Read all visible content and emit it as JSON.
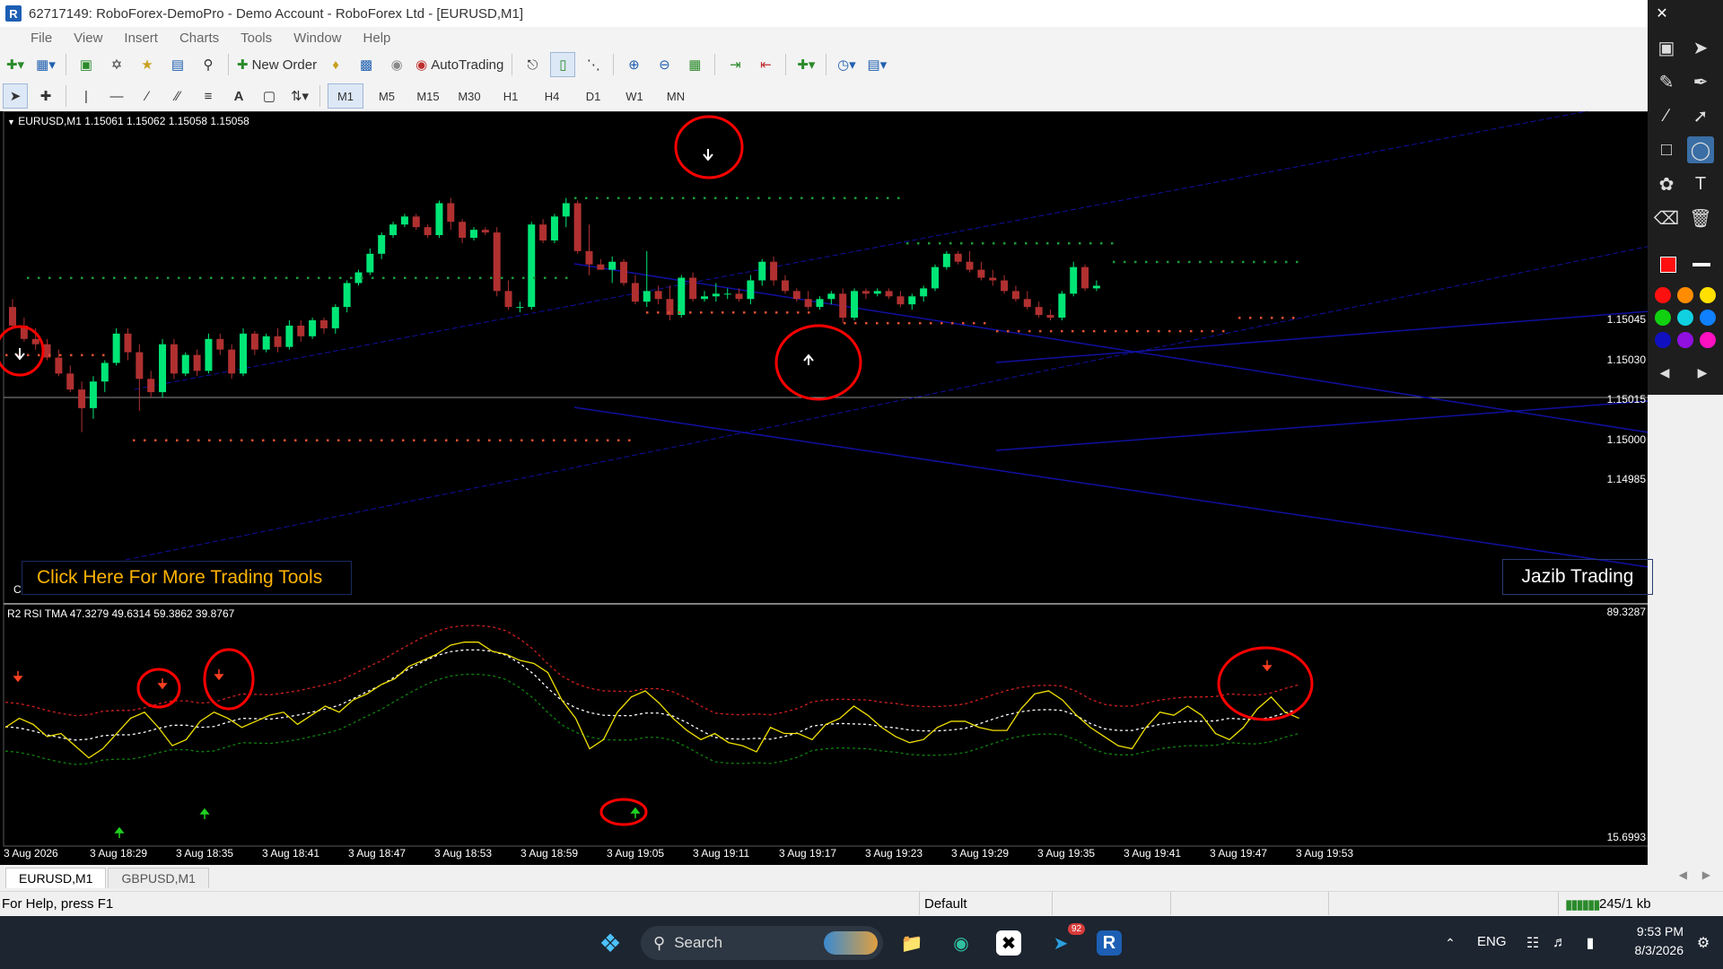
{
  "window": {
    "title": "62717149: RoboForex-DemoPro - Demo Account - RoboForex Ltd - [EURUSD,M1]"
  },
  "menu": [
    "File",
    "View",
    "Insert",
    "Charts",
    "Tools",
    "Window",
    "Help"
  ],
  "toolbar": {
    "new_order": "New Order",
    "autotrading": "AutoTrading"
  },
  "timeframes": [
    "M1",
    "M5",
    "M15",
    "M30",
    "H1",
    "H4",
    "D1",
    "W1",
    "MN"
  ],
  "chart": {
    "symbol_label": "EURUSD,M1  1.15061 1.15062 1.15058 1.15058",
    "indicator_label": "R2 RSI TMA 47.3279 49.6314 59.3862 39.8767",
    "click_here": "Click Here For More Trading Tools",
    "brand": "Jazib Trading",
    "corner_c": "C",
    "price_axis": [
      "1.15045",
      "1.15030",
      "1.15015",
      "1.15000",
      "1.14985"
    ],
    "indicator_axis_top": "89.3287",
    "indicator_axis_bottom": "15.6993",
    "time_axis": [
      "3 Aug 2026",
      "3 Aug 18:29",
      "3 Aug 18:35",
      "3 Aug 18:41",
      "3 Aug 18:47",
      "3 Aug 18:53",
      "3 Aug 18:59",
      "3 Aug 19:05",
      "3 Aug 19:11",
      "3 Aug 19:17",
      "3 Aug 19:23",
      "3 Aug 19:29",
      "3 Aug 19:35",
      "3 Aug 19:41",
      "3 Aug 19:47",
      "3 Aug 19:53"
    ],
    "colors": {
      "bull": "#00e676",
      "bear": "#b03030",
      "rsi": "#f0e000",
      "upper_band": "#d02020",
      "lower_band": "#108010",
      "mid_band": "#ffffff",
      "trendline": "#1010a0",
      "annotation": "#ff0000"
    },
    "candles_ohlc": [
      [
        1.1505,
        1.15053,
        1.15042,
        1.15043
      ],
      [
        1.15043,
        1.15046,
        1.15037,
        1.15038
      ],
      [
        1.15038,
        1.15042,
        1.15034,
        1.15036
      ],
      [
        1.15036,
        1.15038,
        1.1503,
        1.15031
      ],
      [
        1.15031,
        1.15034,
        1.15024,
        1.15025
      ],
      [
        1.15025,
        1.15028,
        1.15018,
        1.15019
      ],
      [
        1.15019,
        1.15022,
        1.15003,
        1.15012
      ],
      [
        1.15012,
        1.15024,
        1.15008,
        1.15022
      ],
      [
        1.15022,
        1.1503,
        1.15018,
        1.15029
      ],
      [
        1.15029,
        1.15042,
        1.15028,
        1.1504
      ],
      [
        1.1504,
        1.15042,
        1.1503,
        1.15033
      ],
      [
        1.15033,
        1.15036,
        1.15011,
        1.15023
      ],
      [
        1.15023,
        1.15026,
        1.15016,
        1.15018
      ],
      [
        1.15018,
        1.15038,
        1.15016,
        1.15036
      ],
      [
        1.15036,
        1.15038,
        1.15023,
        1.15025
      ],
      [
        1.15025,
        1.15033,
        1.15024,
        1.15032
      ],
      [
        1.15032,
        1.15034,
        1.15024,
        1.15026
      ],
      [
        1.15026,
        1.1504,
        1.15025,
        1.15038
      ],
      [
        1.15038,
        1.1504,
        1.15032,
        1.15034
      ],
      [
        1.15034,
        1.15036,
        1.15023,
        1.15025
      ],
      [
        1.15025,
        1.15042,
        1.15024,
        1.1504
      ],
      [
        1.1504,
        1.15041,
        1.15032,
        1.15034
      ],
      [
        1.15034,
        1.1504,
        1.15033,
        1.15039
      ],
      [
        1.15039,
        1.15042,
        1.15033,
        1.15035
      ],
      [
        1.15035,
        1.15045,
        1.15034,
        1.15043
      ],
      [
        1.15043,
        1.15045,
        1.15037,
        1.15039
      ],
      [
        1.15039,
        1.15046,
        1.15038,
        1.15045
      ],
      [
        1.15045,
        1.15046,
        1.1504,
        1.15042
      ],
      [
        1.15042,
        1.15051,
        1.1504,
        1.1505
      ],
      [
        1.1505,
        1.1506,
        1.15048,
        1.15059
      ],
      [
        1.15059,
        1.15064,
        1.15058,
        1.15063
      ],
      [
        1.15063,
        1.15072,
        1.15062,
        1.1507
      ],
      [
        1.1507,
        1.15078,
        1.15068,
        1.15077
      ],
      [
        1.15077,
        1.15082,
        1.15076,
        1.15081
      ],
      [
        1.15081,
        1.15085,
        1.1508,
        1.15084
      ],
      [
        1.15084,
        1.15085,
        1.15079,
        1.1508
      ],
      [
        1.1508,
        1.15081,
        1.15076,
        1.15077
      ],
      [
        1.15077,
        1.1509,
        1.15076,
        1.15089
      ],
      [
        1.15089,
        1.15091,
        1.15079,
        1.15082
      ],
      [
        1.15082,
        1.15083,
        1.15074,
        1.15076
      ],
      [
        1.15076,
        1.1508,
        1.15075,
        1.15079
      ],
      [
        1.15079,
        1.1508,
        1.15077,
        1.15078
      ],
      [
        1.15078,
        1.1508,
        1.15054,
        1.15056
      ],
      [
        1.15056,
        1.1506,
        1.15049,
        1.1505
      ],
      [
        1.1505,
        1.15052,
        1.15048,
        1.1505
      ],
      [
        1.1505,
        1.15082,
        1.15049,
        1.15081
      ],
      [
        1.15081,
        1.15083,
        1.15074,
        1.15075
      ],
      [
        1.15075,
        1.15085,
        1.15074,
        1.15084
      ],
      [
        1.15084,
        1.15091,
        1.1508,
        1.15089
      ],
      [
        1.15089,
        1.1509,
        1.1507,
        1.15071
      ],
      [
        1.15071,
        1.15081,
        1.15062,
        1.15066
      ],
      [
        1.15066,
        1.15068,
        1.15064,
        1.15064
      ],
      [
        1.15064,
        1.15069,
        1.15059,
        1.15067
      ],
      [
        1.15067,
        1.15068,
        1.15058,
        1.15059
      ],
      [
        1.15059,
        1.15062,
        1.15051,
        1.15052
      ],
      [
        1.15052,
        1.15071,
        1.1505,
        1.15056
      ],
      [
        1.15056,
        1.15058,
        1.15051,
        1.15053
      ],
      [
        1.15053,
        1.15058,
        1.15045,
        1.15047
      ],
      [
        1.15047,
        1.15062,
        1.15046,
        1.15061
      ],
      [
        1.15061,
        1.15063,
        1.15052,
        1.15053
      ],
      [
        1.15053,
        1.15056,
        1.15052,
        1.15054
      ],
      [
        1.15054,
        1.15059,
        1.15052,
        1.15055
      ],
      [
        1.15055,
        1.15057,
        1.15053,
        1.15055
      ],
      [
        1.15055,
        1.15057,
        1.15052,
        1.15053
      ],
      [
        1.15053,
        1.15062,
        1.15051,
        1.1506
      ],
      [
        1.1506,
        1.15068,
        1.15058,
        1.15067
      ],
      [
        1.15067,
        1.15069,
        1.15058,
        1.1506
      ],
      [
        1.1506,
        1.15062,
        1.15055,
        1.15056
      ],
      [
        1.15056,
        1.15057,
        1.15052,
        1.15053
      ],
      [
        1.15053,
        1.15056,
        1.15049,
        1.1505
      ],
      [
        1.1505,
        1.15054,
        1.15049,
        1.15053
      ],
      [
        1.15053,
        1.15056,
        1.15051,
        1.15055
      ],
      [
        1.15055,
        1.15057,
        1.15044,
        1.15046
      ],
      [
        1.15046,
        1.15057,
        1.15045,
        1.15056
      ],
      [
        1.15056,
        1.15057,
        1.15053,
        1.15055
      ],
      [
        1.15055,
        1.15057,
        1.15054,
        1.15056
      ],
      [
        1.15056,
        1.15057,
        1.15053,
        1.15054
      ],
      [
        1.15054,
        1.15056,
        1.1505,
        1.15051
      ],
      [
        1.15051,
        1.15055,
        1.15049,
        1.15054
      ],
      [
        1.15054,
        1.15058,
        1.15052,
        1.15057
      ],
      [
        1.15057,
        1.15066,
        1.15056,
        1.15065
      ],
      [
        1.15065,
        1.15071,
        1.15064,
        1.1507
      ],
      [
        1.1507,
        1.15071,
        1.15066,
        1.15067
      ],
      [
        1.15067,
        1.15071,
        1.15063,
        1.15064
      ],
      [
        1.15064,
        1.15067,
        1.1506,
        1.15061
      ],
      [
        1.15061,
        1.15064,
        1.15058,
        1.1506
      ],
      [
        1.1506,
        1.15062,
        1.15055,
        1.15056
      ],
      [
        1.15056,
        1.15058,
        1.15052,
        1.15053
      ],
      [
        1.15053,
        1.15056,
        1.15049,
        1.1505
      ],
      [
        1.1505,
        1.15052,
        1.15046,
        1.15047
      ],
      [
        1.15047,
        1.15049,
        1.15045,
        1.15046
      ],
      [
        1.15046,
        1.15056,
        1.15045,
        1.15055
      ],
      [
        1.15055,
        1.15067,
        1.15054,
        1.15065
      ],
      [
        1.15065,
        1.15066,
        1.15056,
        1.15057
      ],
      [
        1.15057,
        1.1506,
        1.15056,
        1.15058
      ]
    ],
    "rsi_values": [
      52,
      55,
      53,
      49,
      50,
      46,
      42,
      45,
      50,
      55,
      57,
      52,
      46,
      48,
      54,
      57,
      55,
      52,
      54,
      56,
      57,
      53,
      56,
      59,
      57,
      61,
      63,
      66,
      68,
      72,
      74,
      76,
      79,
      80,
      80,
      77,
      76,
      74,
      73,
      70,
      61,
      55,
      45,
      48,
      57,
      62,
      64,
      60,
      55,
      51,
      48,
      50,
      47,
      46,
      44,
      52,
      50,
      50,
      48,
      53,
      55,
      59,
      56,
      52,
      49,
      47,
      48,
      52,
      54,
      54,
      52,
      51,
      51,
      58,
      63,
      64,
      61,
      56,
      52,
      49,
      46,
      45,
      52,
      57,
      56,
      59,
      56,
      50,
      48,
      52,
      58,
      62,
      57,
      55
    ]
  },
  "tabs": [
    "EURUSD,M1",
    "GBPUSD,M1"
  ],
  "status": {
    "help": "For Help, press F1",
    "profile": "Default",
    "traffic": "245/1 kb"
  },
  "taskbar": {
    "search": "Search",
    "lang": "ENG",
    "time": "9:53 PM",
    "date": "8/3/2026",
    "badge": "92"
  }
}
